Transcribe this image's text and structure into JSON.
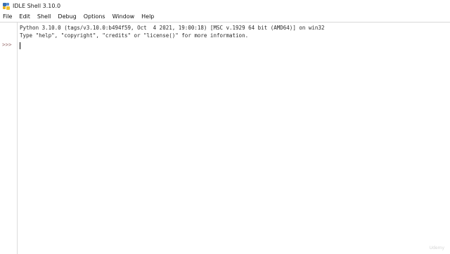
{
  "window": {
    "title": "IDLE Shell 3.10.0"
  },
  "menu": {
    "items": [
      "File",
      "Edit",
      "Shell",
      "Debug",
      "Options",
      "Window",
      "Help"
    ]
  },
  "shell": {
    "banner_line_1": "Python 3.10.0 (tags/v3.10.0:b494f59, Oct  4 2021, 19:00:18) [MSC v.1929 64 bit (AMD64)] on win32",
    "banner_line_2": "Type \"help\", \"copyright\", \"credits\" or \"license()\" for more information.",
    "prompt": ">>>"
  },
  "watermark": "Udemy",
  "icon": {
    "app_icon": "python-idle-icon"
  }
}
